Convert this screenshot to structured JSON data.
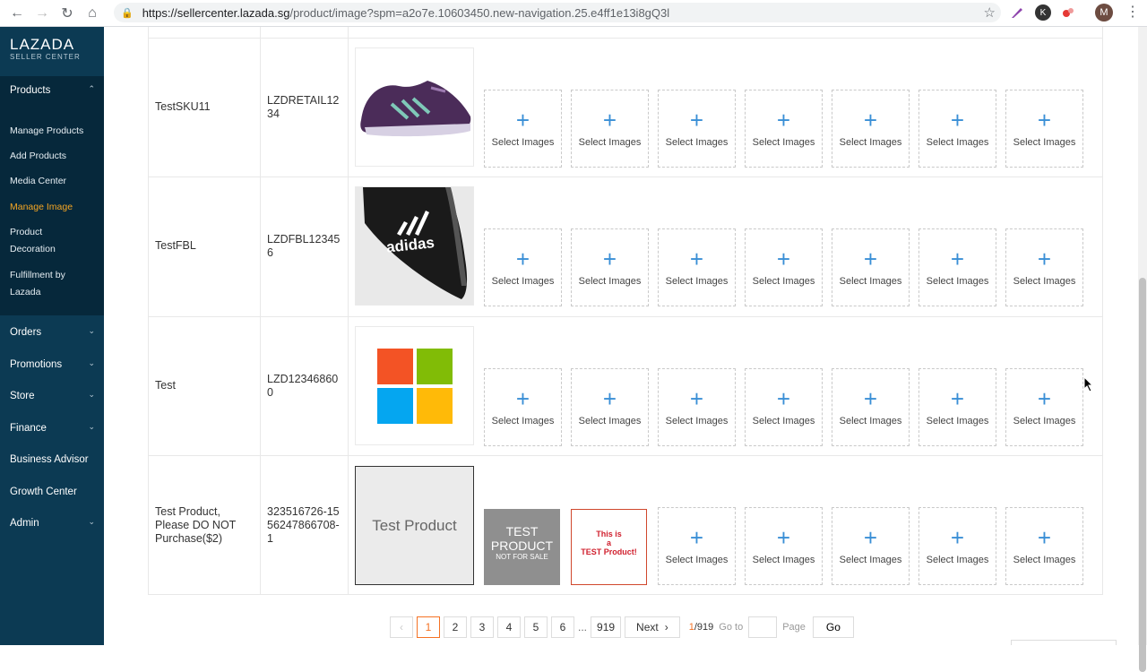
{
  "browser": {
    "url_host": "https://sellercenter.lazada.sg",
    "url_path": "/product/image?spm=a2o7e.10603450.new-navigation.25.e4ff1e13i8gQ3l",
    "avatar_letter": "M",
    "ext_k": "K"
  },
  "sidebar": {
    "logo_main": "LAZADA",
    "logo_sub": "SELLER CENTER",
    "products_label": "Products",
    "sub_items": [
      "Manage Products",
      "Add Products",
      "Media Center",
      "Manage Image",
      "Product Decoration",
      "Fulfillment by Lazada"
    ],
    "sections": [
      "Orders",
      "Promotions",
      "Store",
      "Finance",
      "Business Advisor",
      "Growth Center",
      "Admin"
    ]
  },
  "table": {
    "select_label": "Select Images",
    "rows": [
      {
        "name": "TestSKU11",
        "sku": "LZDRETAIL1234",
        "image": "purple-sneaker"
      },
      {
        "name": "TestFBL",
        "sku": "LZDFBL123456",
        "image": "adidas-slide"
      },
      {
        "name": "Test",
        "sku": "LZD123468600",
        "image": "windows-logo"
      },
      {
        "name": "Test Product, Please DO NOT Purchase($2)",
        "sku": "323516726-1556247866708-1",
        "image": "test-product"
      }
    ],
    "test_main_text": "Test Product",
    "thumb1_line1": "TEST",
    "thumb1_line2": "PRODUCT",
    "thumb1_line3": "NOT FOR SALE",
    "thumb2_line1": "This is",
    "thumb2_line2": "a",
    "thumb2_line3": "TEST Product!"
  },
  "pagination": {
    "pages": [
      "1",
      "2",
      "3",
      "4",
      "5",
      "6"
    ],
    "ellipsis": "...",
    "last": "919",
    "next": "Next",
    "info_current": "1",
    "info_total": "/919",
    "goto_label": "Go to",
    "page_label": "Page",
    "go_button": "Go"
  }
}
